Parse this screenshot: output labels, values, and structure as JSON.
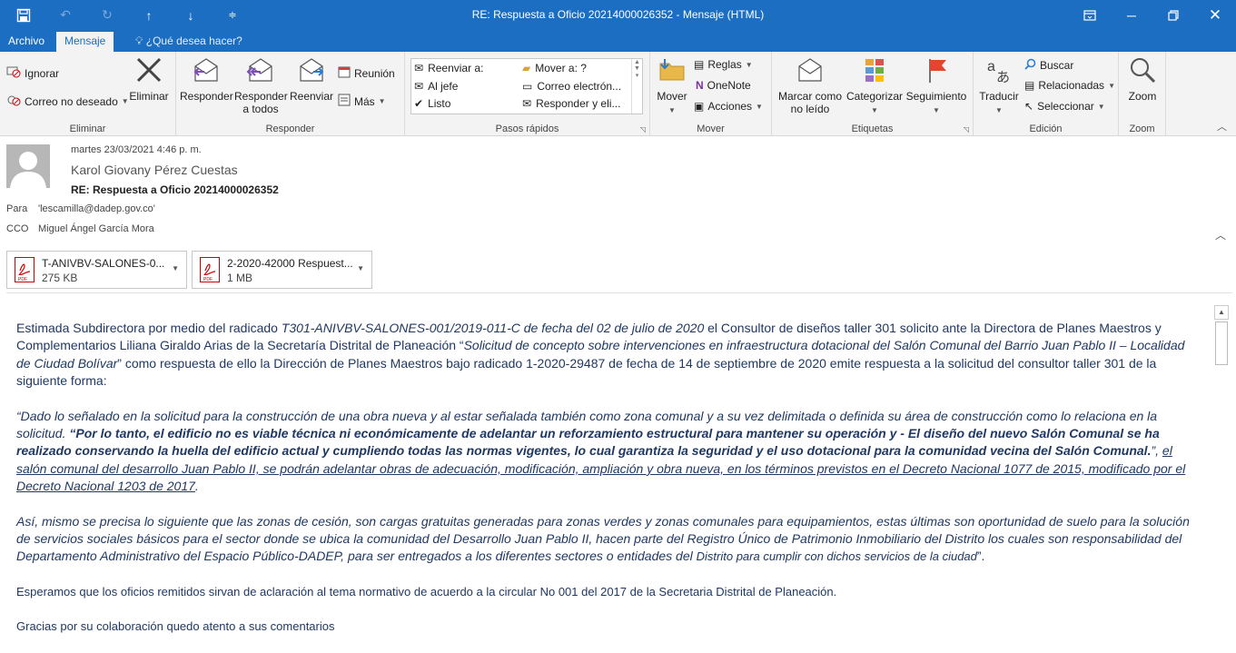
{
  "window": {
    "title": "RE: Respuesta a Oficio 20214000026352 - Mensaje (HTML)"
  },
  "tabs": {
    "archivo": "Archivo",
    "mensaje": "Mensaje",
    "tell_me": "¿Qué desea hacer?"
  },
  "ribbon": {
    "eliminar": {
      "label": "Eliminar",
      "ignorar": "Ignorar",
      "correo_no_deseado": "Correo no deseado",
      "eliminar_button": "Eliminar"
    },
    "responder": {
      "label": "Responder",
      "responder": "Responder",
      "responder_todos_1": "Responder",
      "responder_todos_2": "a todos",
      "reenviar": "Reenviar",
      "reunion": "Reunión",
      "mas": "Más"
    },
    "pasos_rapidos": {
      "label": "Pasos rápidos",
      "reenviar_a": "Reenviar a:",
      "al_jefe": "Al jefe",
      "listo": "Listo",
      "mover_a": "Mover a: ?",
      "correo_electron": "Correo electrón...",
      "responder_y_eli": "Responder y eli..."
    },
    "mover": {
      "label": "Mover",
      "mover": "Mover",
      "reglas": "Reglas",
      "onenote": "OneNote",
      "acciones": "Acciones"
    },
    "etiquetas": {
      "label": "Etiquetas",
      "marcar_1": "Marcar como",
      "marcar_2": "no leído",
      "categorizar": "Categorizar",
      "seguimiento": "Seguimiento"
    },
    "edicion": {
      "label": "Edición",
      "traducir": "Traducir",
      "buscar": "Buscar",
      "relacionadas": "Relacionadas",
      "seleccionar": "Seleccionar"
    },
    "zoom": {
      "label": "Zoom",
      "zoom": "Zoom"
    }
  },
  "message": {
    "date": "martes 23/03/2021 4:46 p. m.",
    "sender": "Karol Giovany Pérez Cuestas",
    "subject": "RE: Respuesta a Oficio 20214000026352",
    "to_label": "Para",
    "to_value": "'lescamilla@dadep.gov.co'",
    "cco_label": "CCO",
    "cco_value": "Miguel Ángel García Mora"
  },
  "attachments": [
    {
      "name": "T-ANIVBV-SALONES-0...",
      "size": "275 KB",
      "type": "PDF"
    },
    {
      "name": "2-2020-42000 Respuest...",
      "size": "1 MB",
      "type": "PDF"
    }
  ],
  "body": {
    "p1_a": "Estimada Subdirectora por medio del radicado ",
    "p1_b": "T301-ANIVBV-SALONES-001/2019-011-C de fecha del 02 de julio de 2020",
    "p1_c": " el Consultor de diseños taller 301 solicito ante la Directora de Planes Maestros y Complementarios Liliana Giraldo Arias de la Secretaría Distrital de Planeación “",
    "p1_d": "Solicitud de concepto sobre intervenciones en infraestructura dotacional del Salón Comunal del Barrio Juan Pablo II – Localidad de Ciudad Bolívar",
    "p1_e": "” como respuesta de ello la Dirección de Planes Maestros bajo radicado 1-2020-29487 de fecha de 14 de septiembre de 2020 emite respuesta a la solicitud del consultor taller 301 de la siguiente forma:",
    "p2_a": "“Dado lo señalado en la solicitud para la construcción de una obra nueva y al estar señalada también como zona comunal y a su vez delimitada o definida su área de construcción como lo relaciona en la solicitud.  ",
    "p2_b": "“Por lo tanto, el edificio no es viable técnica ni económicamente de adelantar un reforzamiento estructural para mantener su operación y - El diseño del nuevo Salón Comunal se ha realizado conservando la huella del edificio actual y cumpliendo todas las normas vigentes, lo cual garantiza la seguridad y el uso dotacional para la comunidad vecina del Salón Comunal.",
    "p2_c": "”, ",
    "p2_d": "el salón comunal del desarrollo Juan Pablo II, se podrán adelantar obras de adecuación, modificación, ampliación y obra nueva, en los términos previstos en el Decreto Nacional 1077 de 2015, modificado por el Decreto Nacional 1203 de 2017",
    "p2_e": ".",
    "p3_a": "Así, mismo se precisa lo siguiente que las zonas de cesión, son cargas gratuitas generadas para zonas verdes y zonas comunales para equipamientos, estas últimas son oportunidad de suelo para la solución de servicios sociales básicos para el sector donde se ubica la comunidad del Desarrollo Juan Pablo II, hacen parte del Registro Único de Patrimonio Inmobiliario del Distrito los cuales son responsabilidad del Departamento Administrativo del Espacio Público-DADEP, para ser entregados a los diferentes sectores o entidades del ",
    "p3_b": "Distrito para cumplir con dichos servicios de la ciudad",
    "p3_c": "”.",
    "p4": "Esperamos que los oficios remitidos sirvan de aclaración al tema normativo de acuerdo a la circular No 001 del 2017 de la Secretaria Distrital de Planeación.",
    "p5": "Gracias por su colaboración quedo atento a sus comentarios"
  }
}
